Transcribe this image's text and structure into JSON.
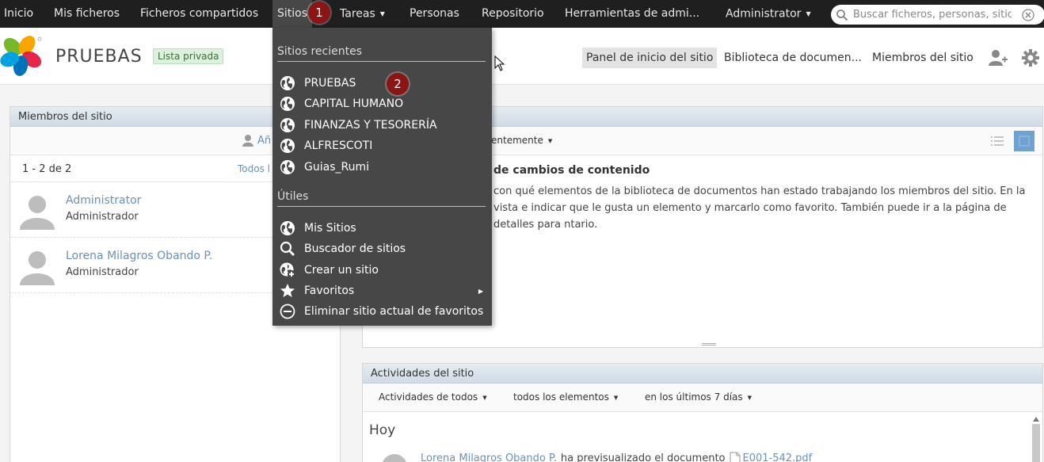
{
  "topnav": {
    "items": [
      {
        "label": "Inicio"
      },
      {
        "label": "Mis ficheros"
      },
      {
        "label": "Ficheros compartidos"
      },
      {
        "label": "Sitios"
      },
      {
        "label": "Tareas"
      },
      {
        "label": "Personas"
      },
      {
        "label": "Repositorio"
      },
      {
        "label": "Herramientas de admi..."
      },
      {
        "label": "Administrator"
      }
    ],
    "search_placeholder": "Buscar ficheros, personas, sitios"
  },
  "site": {
    "title": "PRUEBAS",
    "visibility": "Lista privada",
    "nav": [
      "Panel de inicio del sitio",
      "Biblioteca de documen...",
      "Miembros del sitio"
    ]
  },
  "members": {
    "title": "Miembros del sitio",
    "add_label": "Añ",
    "count": "1 - 2 de 2",
    "all_label": "Todos l",
    "list": [
      {
        "name": "Administrator",
        "role": "Administrador"
      },
      {
        "name": "Lorena Milagros Obando P.",
        "role": "Administrador"
      }
    ]
  },
  "content": {
    "filter": "entemente",
    "info_title": "de cambios de contenido",
    "info_text": "con qué elementos de la biblioteca de documentos han estado trabajando los miembros del sitio. En la vista e indicar que le gusta un elemento y marcarlo como favorito. También puede ir a la página de detalles para ntario."
  },
  "activities": {
    "title": "Actividades del sitio",
    "filters": [
      "Actividades de todos",
      "todos los elementos",
      "en los últimos 7 días"
    ],
    "today": "Hoy",
    "entry": {
      "user": "Lorena Milagros Obando P.",
      "action": "ha previsualizado el documento",
      "doc": "E001-542.pdf"
    }
  },
  "dropdown": {
    "recent_header": "Sitios recientes",
    "recent": [
      "PRUEBAS",
      "CAPITAL HUMANO",
      "FINANZAS Y TESORERÍA",
      "ALFRESCOTI",
      "Guias_Rumi"
    ],
    "utils_header": "Útiles",
    "utils": [
      {
        "label": "Mis Sitios",
        "icon": "globe-icon"
      },
      {
        "label": "Buscador de sitios",
        "icon": "search-icon"
      },
      {
        "label": "Crear un sitio",
        "icon": "globe-plus-icon"
      },
      {
        "label": "Favoritos",
        "icon": "star-icon"
      },
      {
        "label": "Eliminar sitio actual de favoritos",
        "icon": "minus-circle-icon"
      }
    ]
  },
  "markers": [
    "1",
    "2"
  ],
  "colors": {
    "topbar": "#1f1f1f",
    "dropdown": "#474747",
    "link": "#6a91b8",
    "marker": "#8b1414",
    "badge": "#dcf2dc"
  }
}
